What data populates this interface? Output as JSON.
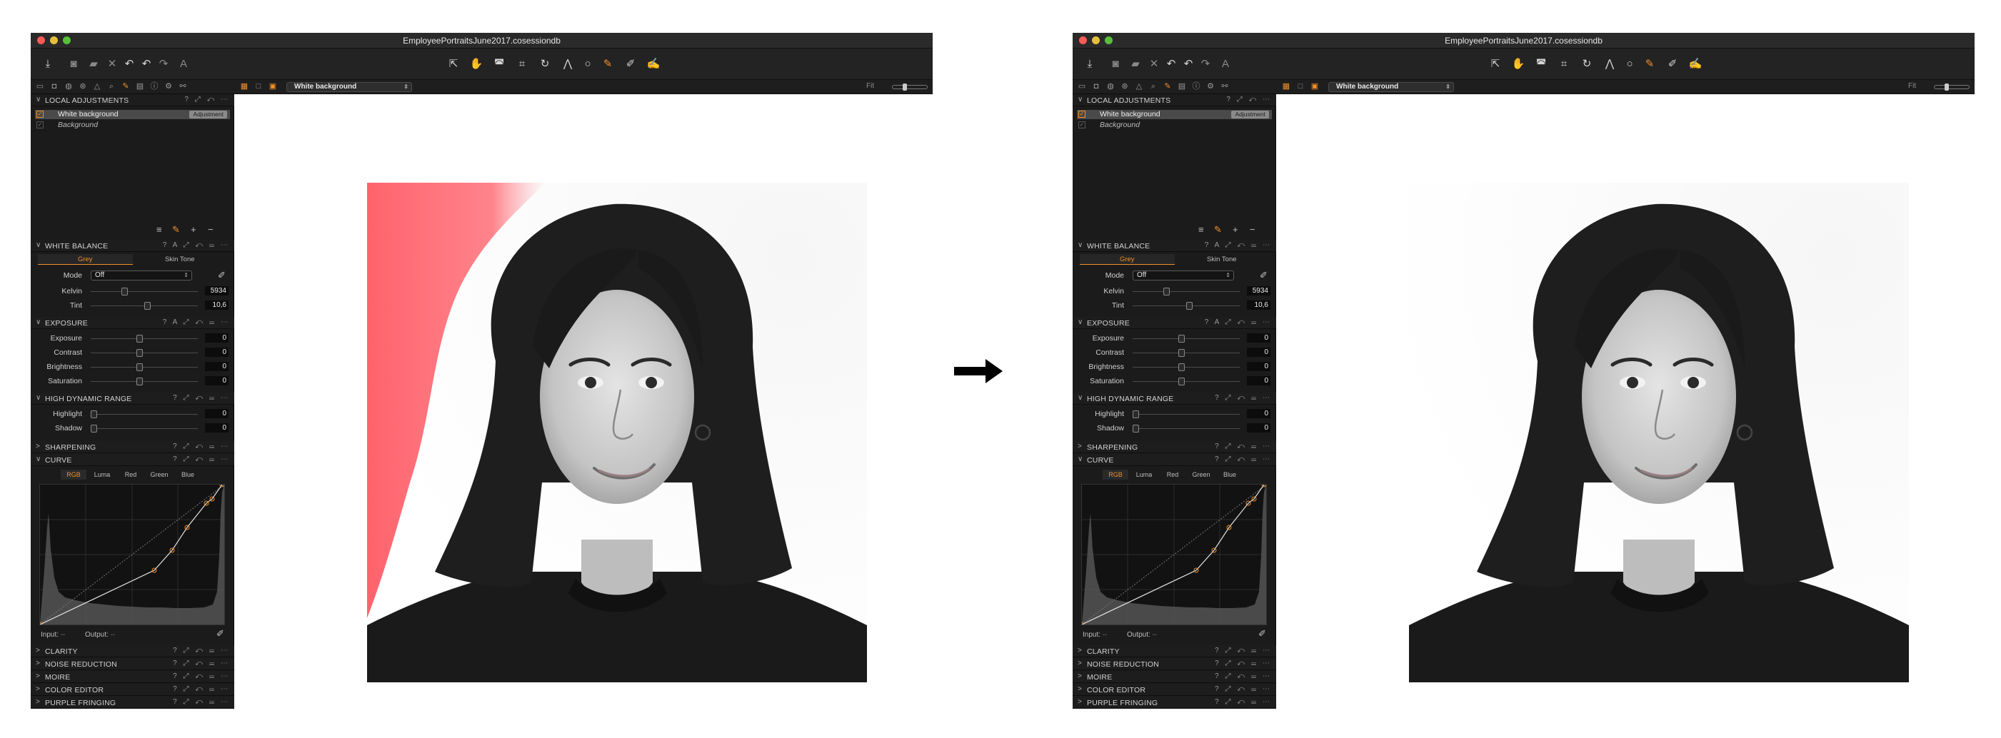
{
  "windows": [
    {
      "id": "before",
      "title": "EmployeePortraitsJune2017.cosessiondb",
      "variant_label": "White background",
      "fit_label": "Fit",
      "local_adjustments": {
        "title": "LOCAL ADJUSTMENTS",
        "layers": [
          {
            "name": "White background",
            "badge": "Adjustment",
            "selected": true
          },
          {
            "name": "Background",
            "badge": "",
            "selected": false
          }
        ]
      },
      "white_balance": {
        "title": "WHITE BALANCE",
        "tabs": [
          "Grey",
          "Skin Tone"
        ],
        "active_tab": "Grey",
        "mode_label": "Mode",
        "mode_value": "Off",
        "kelvin_label": "Kelvin",
        "kelvin_value": "5934",
        "tint_label": "Tint",
        "tint_value": "10,6"
      },
      "exposure": {
        "title": "EXPOSURE",
        "rows": [
          {
            "label": "Exposure",
            "value": "0"
          },
          {
            "label": "Contrast",
            "value": "0"
          },
          {
            "label": "Brightness",
            "value": "0"
          },
          {
            "label": "Saturation",
            "value": "0"
          }
        ]
      },
      "hdr": {
        "title": "HIGH DYNAMIC RANGE",
        "rows": [
          {
            "label": "Highlight",
            "value": "0"
          },
          {
            "label": "Shadow",
            "value": "0"
          }
        ]
      },
      "sharpening_title": "SHARPENING",
      "curve": {
        "title": "CURVE",
        "tabs": [
          "RGB",
          "Luma",
          "Red",
          "Green",
          "Blue"
        ],
        "active_tab": "RGB",
        "input_label": "Input:",
        "input_value": "--",
        "output_label": "Output:",
        "output_value": "--"
      },
      "collapsed_sections": [
        "CLARITY",
        "NOISE REDUCTION",
        "MOIRE",
        "COLOR EDITOR",
        "PURPLE FRINGING"
      ],
      "mask_visible": true
    },
    {
      "id": "after",
      "title": "EmployeePortraitsJune2017.cosessiondb",
      "variant_label": "White background",
      "fit_label": "Fit",
      "local_adjustments": {
        "title": "LOCAL ADJUSTMENTS",
        "layers": [
          {
            "name": "White background",
            "badge": "Adjustment",
            "selected": true
          },
          {
            "name": "Background",
            "badge": "",
            "selected": false
          }
        ]
      },
      "white_balance": {
        "title": "WHITE BALANCE",
        "tabs": [
          "Grey",
          "Skin Tone"
        ],
        "active_tab": "Grey",
        "mode_label": "Mode",
        "mode_value": "Off",
        "kelvin_label": "Kelvin",
        "kelvin_value": "5934",
        "tint_label": "Tint",
        "tint_value": "10,6"
      },
      "exposure": {
        "title": "EXPOSURE",
        "rows": [
          {
            "label": "Exposure",
            "value": "0"
          },
          {
            "label": "Contrast",
            "value": "0"
          },
          {
            "label": "Brightness",
            "value": "0"
          },
          {
            "label": "Saturation",
            "value": "0"
          }
        ]
      },
      "hdr": {
        "title": "HIGH DYNAMIC RANGE",
        "rows": [
          {
            "label": "Highlight",
            "value": "0"
          },
          {
            "label": "Shadow",
            "value": "0"
          }
        ]
      },
      "sharpening_title": "SHARPENING",
      "curve": {
        "title": "CURVE",
        "tabs": [
          "RGB",
          "Luma",
          "Red",
          "Green",
          "Blue"
        ],
        "active_tab": "RGB",
        "input_label": "Input:",
        "input_value": "--",
        "output_label": "Output:",
        "output_value": "--"
      },
      "collapsed_sections": [
        "CLARITY",
        "NOISE REDUCTION",
        "MOIRE",
        "COLOR EDITOR",
        "PURPLE FRINGING"
      ],
      "mask_visible": false
    }
  ],
  "colors": {
    "accent": "#f0902a",
    "mask": "#ff5a64",
    "panel_bg": "#1b1b1b"
  },
  "icons": {
    "toolbar": [
      "import-icon",
      "camera-icon",
      "folder-icon",
      "delete-icon",
      "undo-icon",
      "redo-icon",
      "text-icon",
      "pointer-icon",
      "pan-icon",
      "loupe-icon",
      "crop-icon",
      "rotate-icon",
      "keystone-icon",
      "spot-icon",
      "brush-icon",
      "picker-icon",
      "copy-apply-icon"
    ],
    "transition": "right-arrow-icon"
  }
}
